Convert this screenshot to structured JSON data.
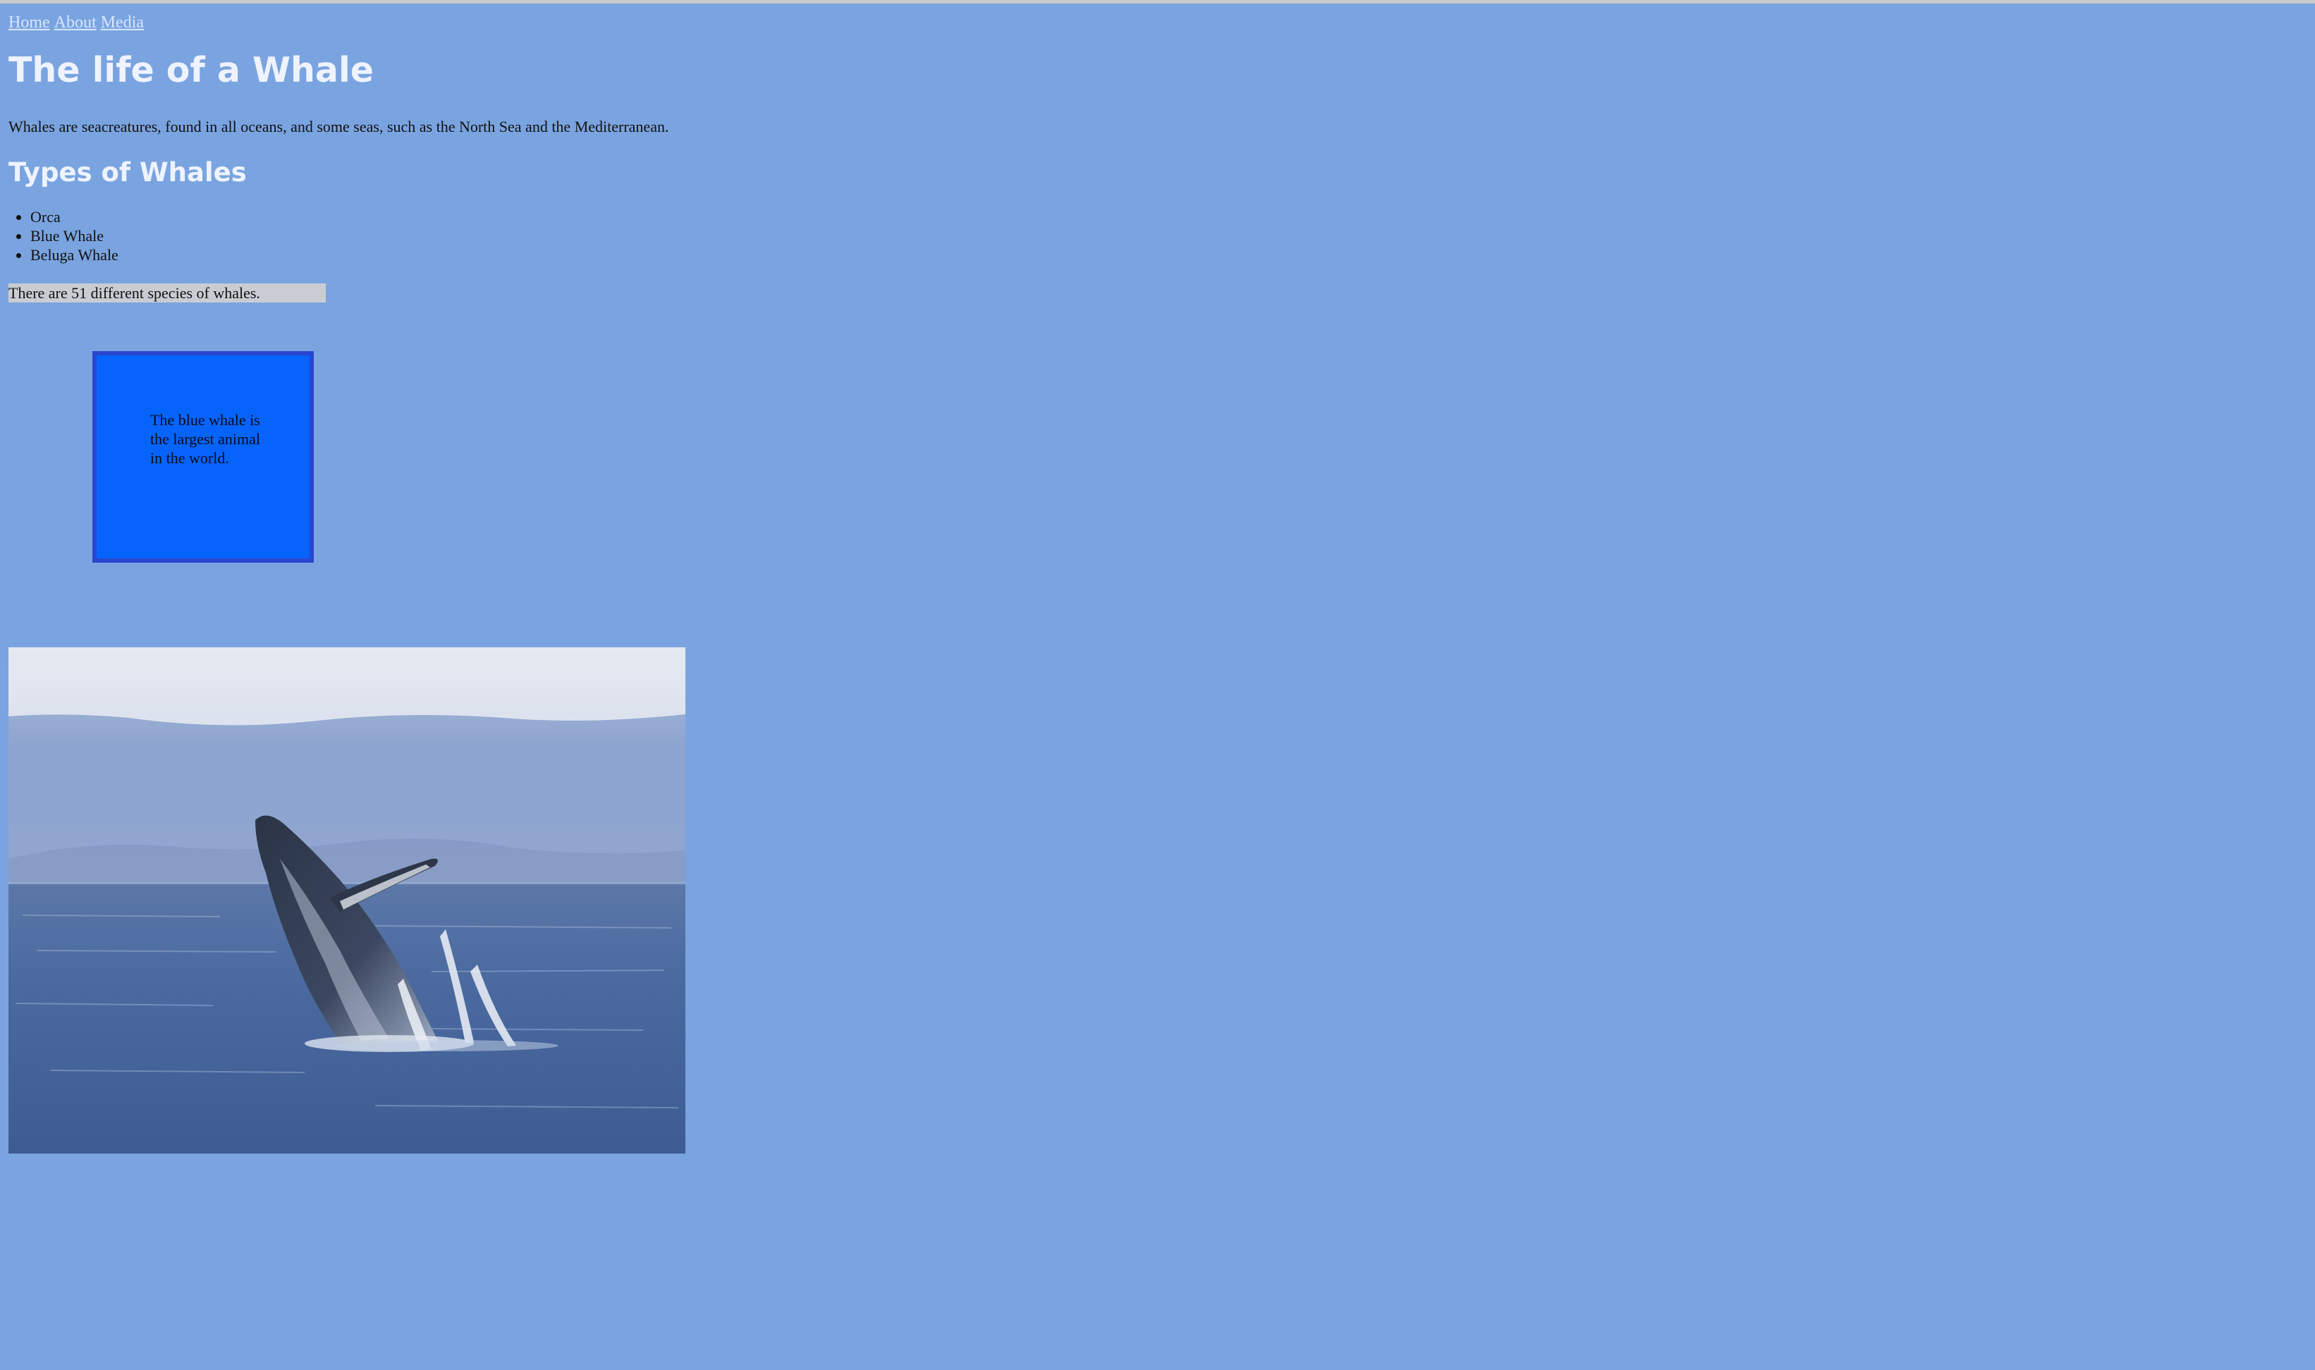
{
  "nav": {
    "home": "Home",
    "about": "About",
    "media": "Media"
  },
  "page": {
    "title": "The life of a Whale",
    "intro": "Whales are seacreatures, found in all oceans, and some seas, such as the North Sea and the Mediterranean.",
    "types_heading": "Types of Whales",
    "types": [
      "Orca",
      "Blue Whale",
      "Beluga Whale"
    ],
    "species_note": "There are 51 different species of whales.",
    "fact_box": "The blue whale is the largest animal in the world."
  },
  "photo": {
    "subject": "humpback-whale-breaching"
  },
  "colors": {
    "background": "#7aa4e0",
    "fact_box_fill": "#0764fa",
    "fact_box_border": "#2a45cf",
    "species_highlight": "#c9cdd3",
    "link": "#d6e6ff"
  }
}
